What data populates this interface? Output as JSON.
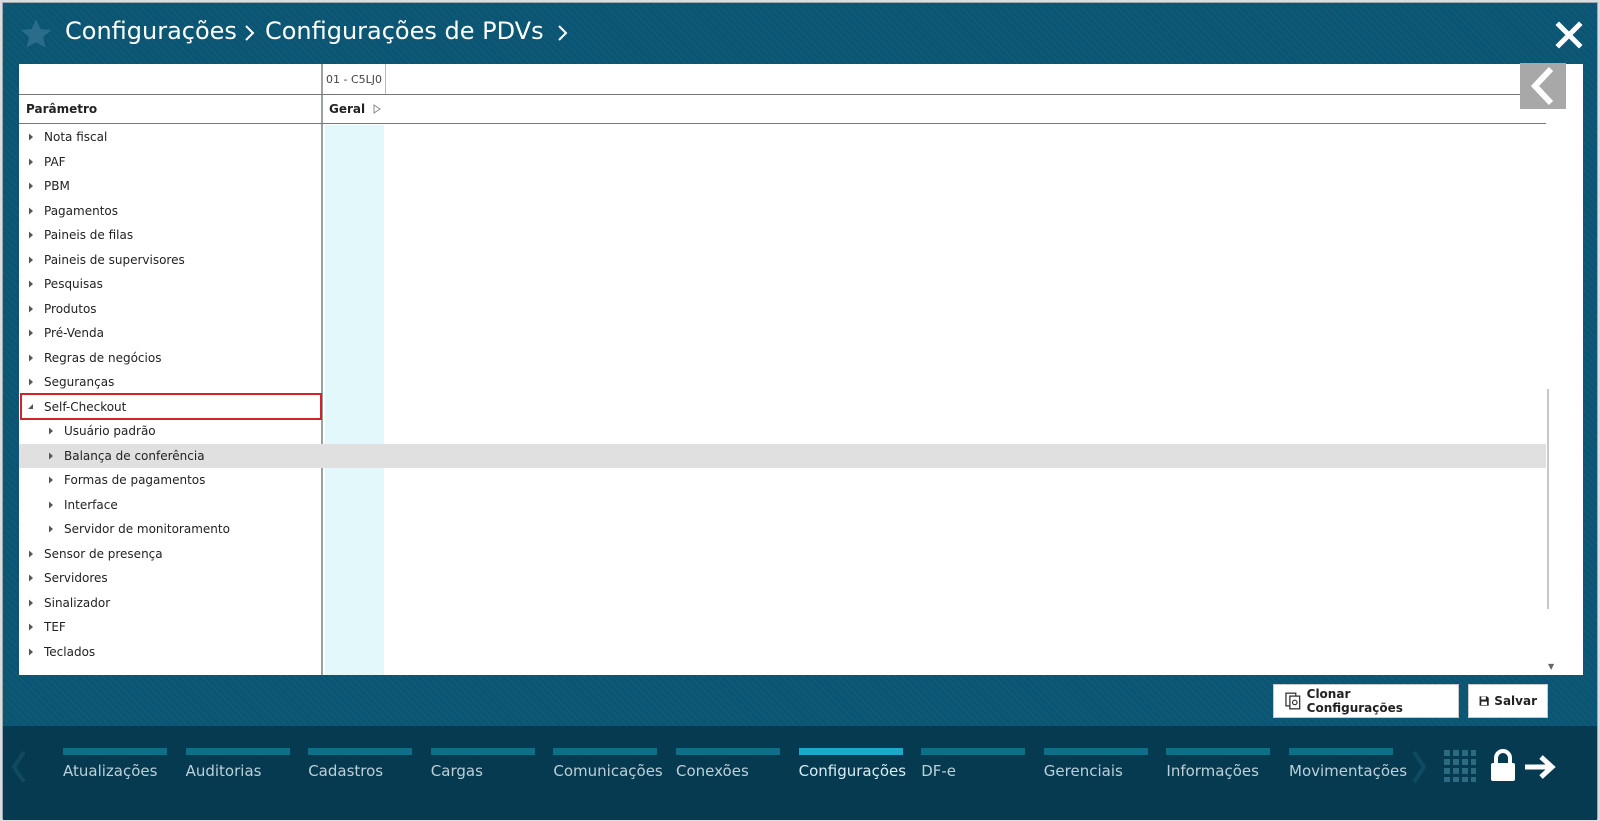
{
  "header": {
    "breadcrumb": [
      "Configurações",
      "Configurações de PDVs"
    ],
    "star_icon": "star-icon",
    "close_icon": "close-icon"
  },
  "grid": {
    "store_column": "01 - C5LJ0",
    "param_header": "Parâmetro",
    "group_header": "Geral"
  },
  "tree": {
    "items": [
      {
        "label": "Nota fiscal",
        "level": 0,
        "expanded": false
      },
      {
        "label": "PAF",
        "level": 0,
        "expanded": false
      },
      {
        "label": "PBM",
        "level": 0,
        "expanded": false
      },
      {
        "label": "Pagamentos",
        "level": 0,
        "expanded": false
      },
      {
        "label": "Paineis de filas",
        "level": 0,
        "expanded": false
      },
      {
        "label": "Paineis de supervisores",
        "level": 0,
        "expanded": false
      },
      {
        "label": "Pesquisas",
        "level": 0,
        "expanded": false
      },
      {
        "label": "Produtos",
        "level": 0,
        "expanded": false
      },
      {
        "label": "Pré-Venda",
        "level": 0,
        "expanded": false
      },
      {
        "label": "Regras de negócios",
        "level": 0,
        "expanded": false
      },
      {
        "label": "Seguranças",
        "level": 0,
        "expanded": false
      },
      {
        "label": "Self-Checkout",
        "level": 0,
        "expanded": true
      },
      {
        "label": "Usuário padrão",
        "level": 1,
        "expanded": false
      },
      {
        "label": "Balança de conferência",
        "level": 1,
        "expanded": false,
        "selected": true
      },
      {
        "label": "Formas de pagamentos",
        "level": 1,
        "expanded": false
      },
      {
        "label": "Interface",
        "level": 1,
        "expanded": false
      },
      {
        "label": "Servidor de monitoramento",
        "level": 1,
        "expanded": false
      },
      {
        "label": "Sensor de presença",
        "level": 0,
        "expanded": false
      },
      {
        "label": "Servidores",
        "level": 0,
        "expanded": false
      },
      {
        "label": "Sinalizador",
        "level": 0,
        "expanded": false
      },
      {
        "label": "TEF",
        "level": 0,
        "expanded": false
      },
      {
        "label": "Teclados",
        "level": 0,
        "expanded": false
      }
    ]
  },
  "actions": {
    "clone_label": "Clonar Configurações",
    "save_label": "Salvar"
  },
  "nav": {
    "items": [
      {
        "label": "Atualizações"
      },
      {
        "label": "Auditorias"
      },
      {
        "label": "Cadastros"
      },
      {
        "label": "Cargas"
      },
      {
        "label": "Comunicações"
      },
      {
        "label": "Conexões"
      },
      {
        "label": "Configurações",
        "active": true
      },
      {
        "label": "DF-e"
      },
      {
        "label": "Gerenciais"
      },
      {
        "label": "Informações"
      },
      {
        "label": "Movimentações"
      }
    ]
  },
  "colors": {
    "header_bg": "#0a5573",
    "nav_bg": "#053a50",
    "nav_active": "#1ba9c8",
    "highlight": "#d2232a",
    "cyan_column": "#e3f8fa"
  }
}
